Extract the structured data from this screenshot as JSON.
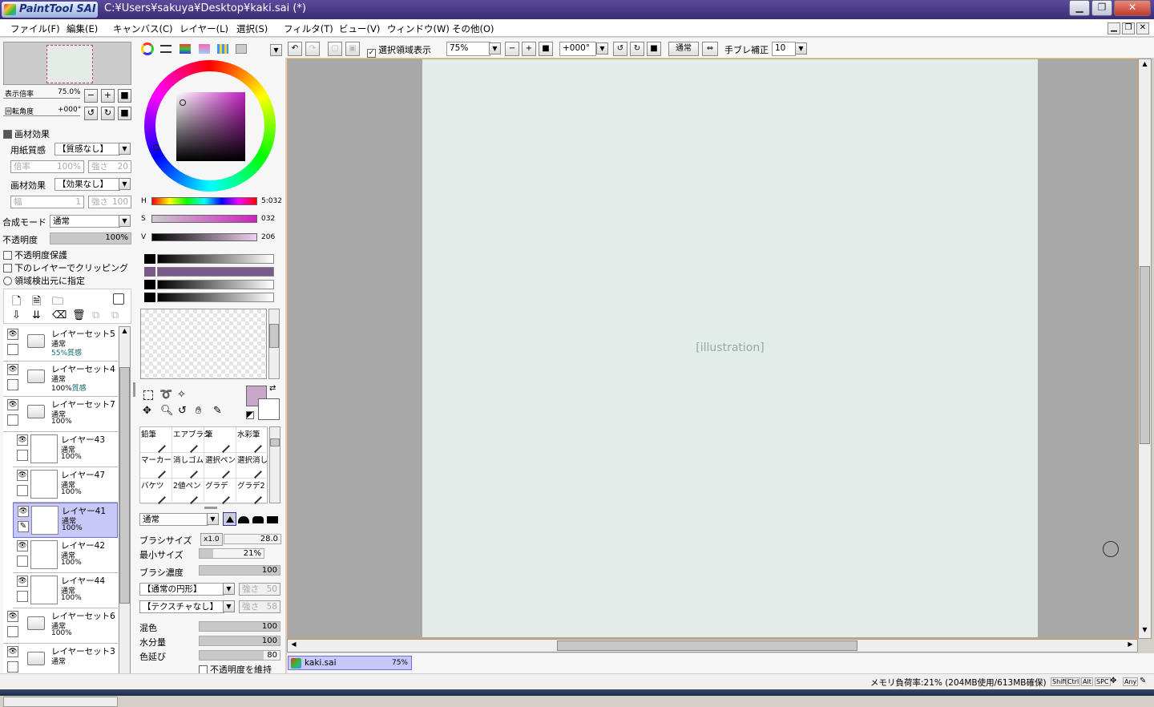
{
  "window": {
    "app_logo": "PaintTool SAI",
    "title": "C:¥Users¥sakuya¥Desktop¥kaki.sai (*)"
  },
  "menu": [
    "ファイル(F)",
    "編集(E)",
    "キャンバス(C)",
    "レイヤー(L)",
    "選択(S)",
    "フィルタ(T)",
    "ビュー(V)",
    "ウィンドウ(W)",
    "その他(O)"
  ],
  "navigator": {
    "zoom_label": "表示倍率",
    "zoom_value": "75.0%",
    "rotation_label": "回転角度",
    "rotation_value": "+000°"
  },
  "paper_effects": {
    "header": "画材効果",
    "texture_label": "用紙質感",
    "texture_value": "【質感なし】",
    "tex_scale_label": "倍率",
    "tex_scale_value": "100%",
    "tex_strength_label": "強さ",
    "tex_strength_value": "20",
    "effect_label": "画材効果",
    "effect_value": "【効果なし】",
    "eff_width_label": "幅",
    "eff_width_value": "1",
    "eff_strength_label": "強さ",
    "eff_strength_value": "100"
  },
  "layer_props": {
    "blend_label": "合成モード",
    "blend_value": "通常",
    "opacity_label": "不透明度",
    "opacity_value": "100%",
    "opacity_fraction": 1.0,
    "protect_label": "不透明度保護",
    "clip_label": "下のレイヤーでクリッピング",
    "select_src_label": "領域検出元に指定"
  },
  "layers": [
    {
      "name": "レイヤーセット5",
      "mode": "通常",
      "props": "55%",
      "extra": "質感",
      "type": "folder",
      "indent": false,
      "selected": false
    },
    {
      "name": "レイヤーセット4",
      "mode": "通常",
      "props": "100%",
      "extra": "質感",
      "type": "folder",
      "indent": false,
      "selected": false
    },
    {
      "name": "レイヤーセット7",
      "mode": "通常",
      "props": "100%",
      "extra": "",
      "type": "folder",
      "indent": false,
      "selected": false
    },
    {
      "name": "レイヤー43",
      "mode": "通常",
      "props": "100%",
      "extra": "",
      "type": "layer",
      "indent": true,
      "selected": false
    },
    {
      "name": "レイヤー47",
      "mode": "通常",
      "props": "100%",
      "extra": "",
      "type": "layer",
      "indent": true,
      "selected": false
    },
    {
      "name": "レイヤー41",
      "mode": "通常",
      "props": "100%",
      "extra": "",
      "type": "layer",
      "indent": true,
      "selected": true
    },
    {
      "name": "レイヤー42",
      "mode": "通常",
      "props": "100%",
      "extra": "",
      "type": "layer",
      "indent": true,
      "selected": false
    },
    {
      "name": "レイヤー44",
      "mode": "通常",
      "props": "100%",
      "extra": "",
      "type": "layer",
      "indent": true,
      "selected": false
    },
    {
      "name": "レイヤーセット6",
      "mode": "通常",
      "props": "100%",
      "extra": "",
      "type": "folder",
      "indent": false,
      "selected": false
    },
    {
      "name": "レイヤーセット3",
      "mode": "通常",
      "props": "",
      "extra": "",
      "type": "folder",
      "indent": false,
      "selected": false
    }
  ],
  "color": {
    "h_label": "H",
    "h_value": "5:032",
    "s_label": "S",
    "s_value": "032",
    "v_label": "V",
    "v_value": "206",
    "current_color": "#c8a8c8",
    "swatches": [
      "#000000",
      "#7a5a8a",
      "#000000",
      "#000000"
    ]
  },
  "tools": [
    {
      "label": "鉛筆"
    },
    {
      "label": "エアブラシ"
    },
    {
      "label": "筆"
    },
    {
      "label": "水彩筆"
    },
    {
      "label": "マーカー"
    },
    {
      "label": "消しゴム"
    },
    {
      "label": "選択ペン"
    },
    {
      "label": "選択消し"
    },
    {
      "label": "バケツ"
    },
    {
      "label": "2値ペン"
    },
    {
      "label": "グラデ"
    },
    {
      "label": "グラデ2"
    }
  ],
  "brush": {
    "mode_value": "通常",
    "size_label": "ブラシサイズ",
    "size_mult": "x1.0",
    "size_value": "28.0",
    "min_size_label": "最小サイズ",
    "min_size_value": "21%",
    "min_size_fraction": 0.21,
    "density_label": "ブラシ濃度",
    "density_value": "100",
    "density_fraction": 1.0,
    "shape_value": "【通常の円形】",
    "shape_strength_label": "強さ",
    "shape_strength_value": "50",
    "texture_value": "【テクスチャなし】",
    "texture_strength_label": "強さ",
    "texture_strength_value": "58",
    "blend_label": "混色",
    "blend_value": "100",
    "dilution_label": "水分量",
    "dilution_value": "100",
    "persistence_label": "色延び",
    "persistence_value": "80",
    "keep_opacity_label": "不透明度を維持"
  },
  "toolbar": {
    "show_selection_label": "選択領域表示",
    "zoom_value": "75%",
    "angle_value": "+000°",
    "mode_value": "通常",
    "stabilizer_label": "手ブレ補正",
    "stabilizer_value": "10"
  },
  "canvas": {
    "placeholder_label": "[illustration]"
  },
  "tab": {
    "file": "kaki.sai",
    "zoom": "75%"
  },
  "status": {
    "memory": "メモリ負荷率:21% (204MB使用/613MB確保)",
    "keys": [
      "Shift",
      "Ctrl",
      "Alt",
      "SPC",
      "Any"
    ]
  }
}
